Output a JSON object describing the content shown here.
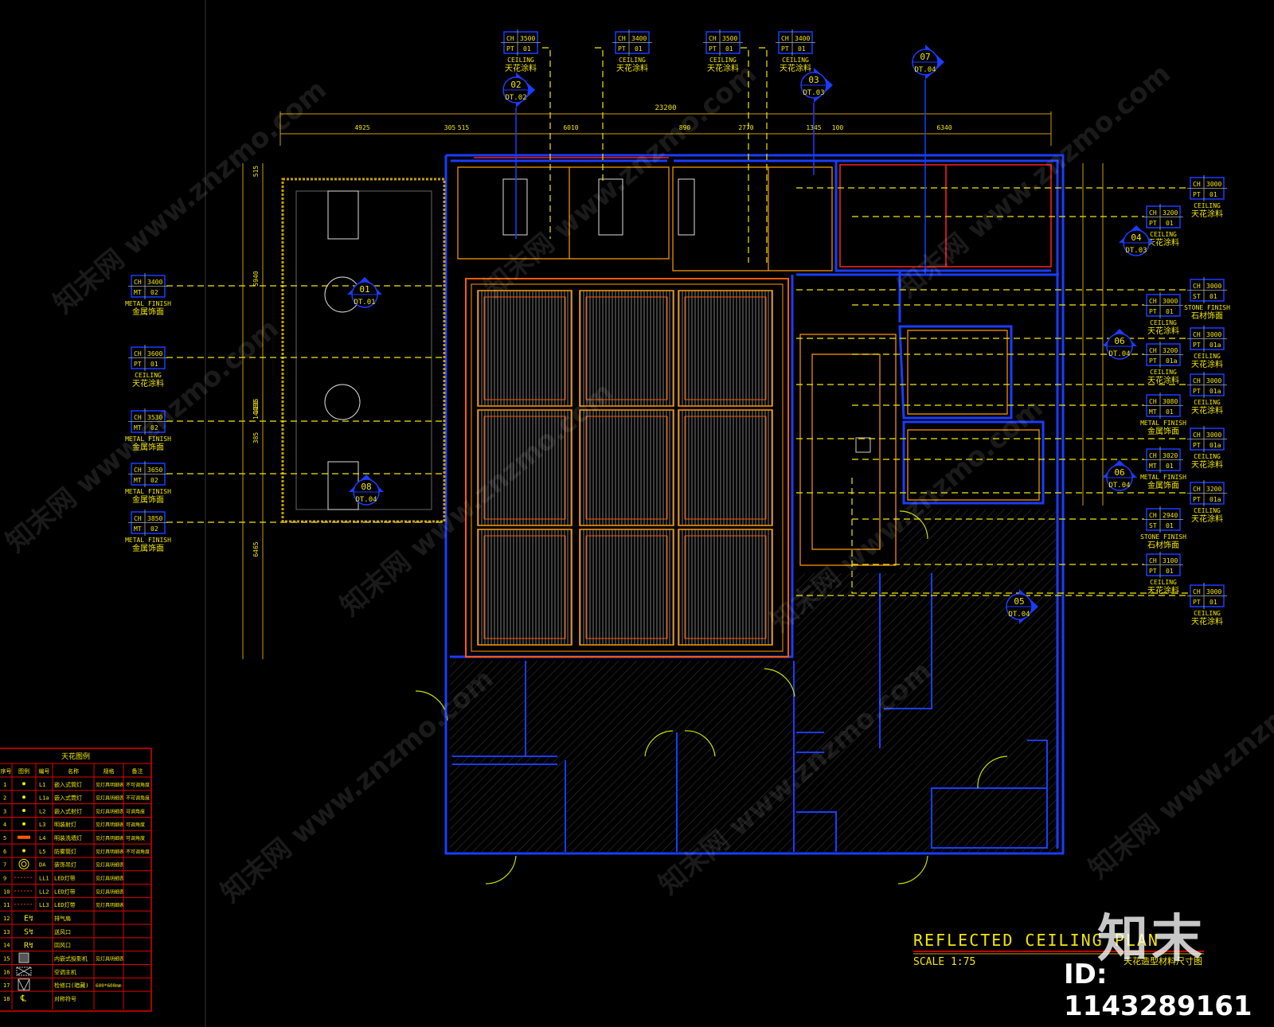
{
  "title": {
    "main": "REFLECTED CEILING PLAN",
    "scale": "SCALE 1:75",
    "subtitle_cn": "天花造型材料尺寸图"
  },
  "watermark": {
    "brand": "知末",
    "id": "ID: 1143289161",
    "site": "知末网 www.znzmo.com"
  },
  "colors": {
    "background": "#000000",
    "text": "#f2e600",
    "wall": "#1a3cff",
    "ceiling_grid": "#ff7a00",
    "legend_border": "#e00000",
    "dimension": "#c8a000"
  },
  "dimensions": {
    "top_total": "23200",
    "top": [
      "4925",
      "305",
      "515",
      "6010",
      "890",
      "2770",
      "1345",
      "100",
      "6340"
    ],
    "left": [
      "515",
      "5940",
      "14480",
      "1135",
      "385",
      "6465"
    ]
  },
  "tags": {
    "top": [
      {
        "ch": "3500",
        "code": "PT",
        "num": "01",
        "en": "CEILING",
        "cn": "天花涂料"
      },
      {
        "ch": "3400",
        "code": "PT",
        "num": "01",
        "en": "CEILING",
        "cn": "天花涂料"
      },
      {
        "ch": "3500",
        "code": "PT",
        "num": "01",
        "en": "CEILING",
        "cn": "天花涂料"
      },
      {
        "ch": "3400",
        "code": "PT",
        "num": "01",
        "en": "CEILING",
        "cn": "天花涂料"
      }
    ],
    "left": [
      {
        "ch": "3400",
        "code": "MT",
        "num": "02",
        "en": "METAL FINISH",
        "cn": "金属饰面"
      },
      {
        "ch": "3600",
        "code": "PT",
        "num": "01",
        "en": "CEILING",
        "cn": "天花涂料"
      },
      {
        "ch": "3530",
        "code": "MT",
        "num": "02",
        "en": "METAL FINISH",
        "cn": "金属饰面"
      },
      {
        "ch": "3650",
        "code": "MT",
        "num": "02",
        "en": "METAL FINISH",
        "cn": "金属饰面"
      },
      {
        "ch": "3850",
        "code": "MT",
        "num": "02",
        "en": "METAL FINISH",
        "cn": "金属饰面"
      }
    ],
    "right_outer": [
      {
        "ch": "3000",
        "code": "PT",
        "num": "01",
        "en": "CEILING",
        "cn": "天花涂料"
      },
      {
        "ch": "3000",
        "code": "ST",
        "num": "01",
        "en": "STONE FINISH",
        "cn": "石材饰面"
      },
      {
        "ch": "3000",
        "code": "PT",
        "num": "01a",
        "en": "CEILING",
        "cn": "天花涂料"
      },
      {
        "ch": "3000",
        "code": "PT",
        "num": "01a",
        "en": "CEILING",
        "cn": "天花涂料"
      },
      {
        "ch": "3000",
        "code": "PT",
        "num": "01a",
        "en": "CEILING",
        "cn": "天花涂料"
      },
      {
        "ch": "3200",
        "code": "PT",
        "num": "01a",
        "en": "CEILING",
        "cn": "天花涂料"
      },
      {
        "ch": "3000",
        "code": "PT",
        "num": "01",
        "en": "CEILING",
        "cn": "天花涂料"
      }
    ],
    "right_inner": [
      {
        "ch": "3200",
        "code": "PT",
        "num": "01",
        "en": "CEILING",
        "cn": "天花涂料"
      },
      {
        "ch": "3000",
        "code": "PT",
        "num": "01",
        "en": "CEILING",
        "cn": "天花涂料"
      },
      {
        "ch": "3200",
        "code": "PT",
        "num": "01a",
        "en": "CEILING",
        "cn": "天花涂料"
      },
      {
        "ch": "3080",
        "code": "MT",
        "num": "01",
        "en": "METAL FINISH",
        "cn": "金属饰面"
      },
      {
        "ch": "3020",
        "code": "MT",
        "num": "01",
        "en": "METAL FINISH",
        "cn": "金属饰面"
      },
      {
        "ch": "2940",
        "code": "ST",
        "num": "01",
        "en": "STONE FINISH",
        "cn": "石材饰面"
      },
      {
        "ch": "3100",
        "code": "PT",
        "num": "01",
        "en": "CEILING",
        "cn": "天花涂料"
      }
    ]
  },
  "section_markers": [
    {
      "num": "02",
      "sheet": "DT.02"
    },
    {
      "num": "03",
      "sheet": "DT.03"
    },
    {
      "num": "07",
      "sheet": "DT.04"
    },
    {
      "num": "04",
      "sheet": "DT.03"
    },
    {
      "num": "06",
      "sheet": "DT.04"
    },
    {
      "num": "06",
      "sheet": "DT.04"
    },
    {
      "num": "05",
      "sheet": "DT.04"
    },
    {
      "num": "01",
      "sheet": "DT.01"
    },
    {
      "num": "08",
      "sheet": "DT.04"
    }
  ],
  "legend": {
    "title": "天花图例",
    "headers": [
      "序号",
      "图例",
      "编号",
      "名称",
      "规格",
      "备注"
    ],
    "rows": [
      {
        "no": "1",
        "code": "L1",
        "name": "嵌入式筒灯",
        "spec": "见灯具明细表",
        "note": "不可调角度",
        "icon": "dot"
      },
      {
        "no": "2",
        "code": "L1a",
        "name": "嵌入式筒灯",
        "spec": "见灯具明细表",
        "note": "不可调角度",
        "icon": "dot"
      },
      {
        "no": "3",
        "code": "L2",
        "name": "嵌入式射灯",
        "spec": "见灯具明细表",
        "note": "可调角度",
        "icon": "dot"
      },
      {
        "no": "4",
        "code": "L3",
        "name": "明装射灯",
        "spec": "见灯具明细表",
        "note": "可调角度",
        "icon": "dot"
      },
      {
        "no": "5",
        "code": "L4",
        "name": "明装洗墙灯",
        "spec": "见灯具明细表",
        "note": "可调角度",
        "icon": "bar"
      },
      {
        "no": "6",
        "code": "L5",
        "name": "防雾筒灯",
        "spec": "见灯具明细表",
        "note": "不可调角度",
        "icon": "dot"
      },
      {
        "no": "7",
        "code": "DA",
        "name": "装饰吊灯",
        "spec": "见灯具明细表",
        "note": "",
        "icon": "ring"
      },
      {
        "no": "9",
        "code": "LL1",
        "name": "LED灯带",
        "spec": "见灯具明细表",
        "note": "",
        "icon": "dash"
      },
      {
        "no": "10",
        "code": "LL2",
        "name": "LED灯带",
        "spec": "见灯具明细表",
        "note": "",
        "icon": "dash"
      },
      {
        "no": "11",
        "code": "LL3",
        "name": "LED灯带",
        "spec": "见灯具明细表",
        "note": "",
        "icon": "dash"
      },
      {
        "no": "12",
        "code": "",
        "name": "排气扇",
        "spec": "",
        "note": "",
        "icon": "E"
      },
      {
        "no": "13",
        "code": "",
        "name": "送风口",
        "spec": "",
        "note": "",
        "icon": "S"
      },
      {
        "no": "14",
        "code": "",
        "name": "回风口",
        "spec": "",
        "note": "",
        "icon": "R"
      },
      {
        "no": "15",
        "code": "",
        "name": "内嵌式投影机",
        "spec": "见灯具明细表",
        "note": "",
        "icon": "box"
      },
      {
        "no": "16",
        "code": "",
        "name": "空调主机",
        "spec": "",
        "note": "",
        "icon": "cross"
      },
      {
        "no": "17",
        "code": "",
        "name": "检修口(暗藏)",
        "spec": "600*600mm",
        "note": "",
        "icon": "hatch"
      },
      {
        "no": "18",
        "code": "",
        "name": "对称符号",
        "spec": "",
        "note": "",
        "icon": "sym"
      }
    ]
  }
}
